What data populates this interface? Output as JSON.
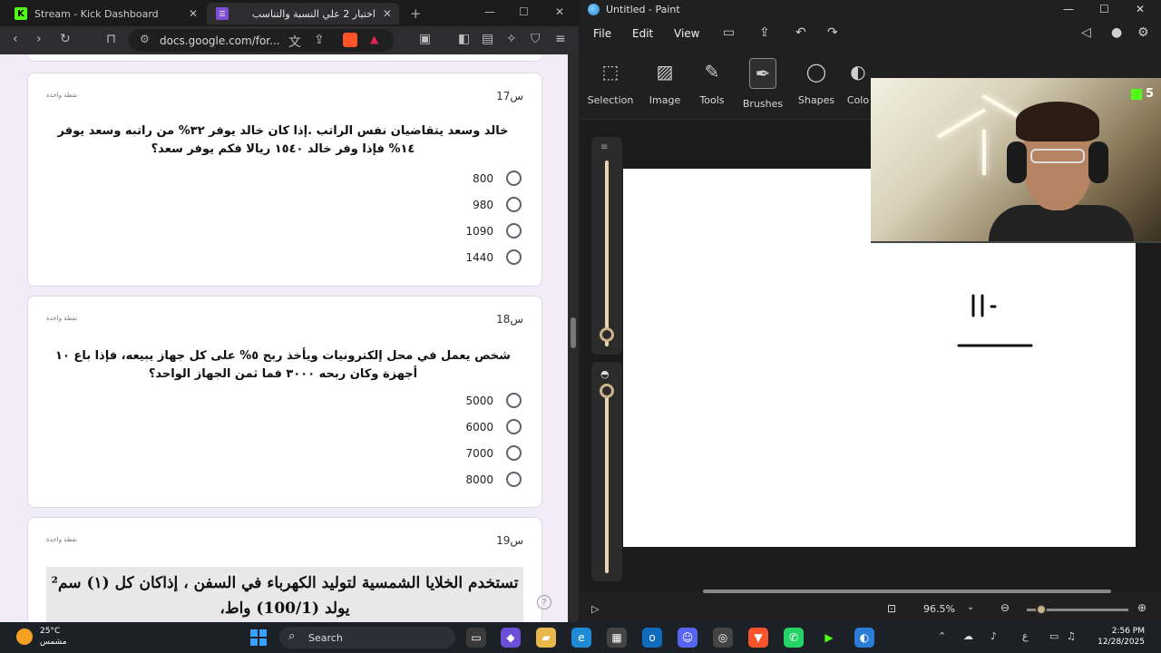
{
  "browser": {
    "tabs": [
      {
        "label": "Stream - Kick Dashboard",
        "close": "✕"
      },
      {
        "label": "اختبار 2 علي النسبة والتناسب",
        "close": "✕"
      }
    ],
    "new_tab": "+",
    "url": "docs.google.com/for...",
    "window_controls": {
      "minimize": "—",
      "maximize": "☐",
      "close": "✕"
    }
  },
  "form": {
    "questions": [
      {
        "number": "س17",
        "points": "نقطة واحدة",
        "text": "خالد وسعد يتقاضيان نفس الراتب .إذا كان خالد يوفر ٣٢% من راتبه وسعد يوفر ١٤% فإذا وفر خالد ١٥٤٠ ريالا فكم يوفر سعد؟",
        "options": [
          "800",
          "980",
          "1090",
          "1440"
        ]
      },
      {
        "number": "س18",
        "points": "نقطة واحدة",
        "text": "شخص يعمل في محل إلكترونيات ويأخذ ربح ٥% على كل جهاز يبيعه، فإذا باع ١٠ أجهزة وكان ربحه ٣٠٠٠ فما ثمن الجهاز الواحد؟",
        "options": [
          "5000",
          "6000",
          "7000",
          "8000"
        ]
      },
      {
        "number": "س19",
        "points": "نقطة واحدة",
        "text": "تستخدم الخلايا الشمسية لتوليد الكهرباء في السفن ، إذاكان كل (١) سم² يولد (100/1) واط،"
      }
    ],
    "help": "?"
  },
  "paint": {
    "title": "Untitled - Paint",
    "menu": [
      "File",
      "Edit",
      "View"
    ],
    "ribbon": [
      "Selection",
      "Image",
      "Tools",
      "Brushes",
      "Shapes",
      "Colo"
    ],
    "zoom": "96.5%",
    "window_controls": {
      "minimize": "—",
      "maximize": "☐",
      "close": "✕"
    }
  },
  "webcam": {
    "kick_viewers": "5"
  },
  "taskbar": {
    "weather_temp": "25°C",
    "weather_desc": "مشمس",
    "search": "Search",
    "time": "2:56 PM",
    "date": "12/28/2025",
    "lang": "ع"
  }
}
